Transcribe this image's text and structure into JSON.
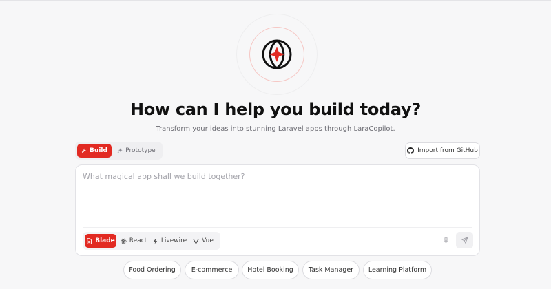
{
  "header": {
    "title": "How can I help you build today?",
    "subtitle": "Transform your ideas into stunning Laravel apps through LaraCopilot."
  },
  "logo": {
    "icon": "globe-sparkle-icon",
    "accent": "#e22a22"
  },
  "mode_switch": {
    "selected": "Build",
    "options": [
      {
        "label": "Build",
        "icon": "wrench-icon"
      },
      {
        "label": "Prototype",
        "icon": "sparkle-icon"
      }
    ]
  },
  "import_button": {
    "label": "Import from GitHub",
    "icon": "github-icon"
  },
  "prompt": {
    "placeholder": "What magical app shall we build together?",
    "value": ""
  },
  "frameworks": {
    "selected": "Blade",
    "options": [
      {
        "label": "Blade",
        "icon": "file-icon"
      },
      {
        "label": "React",
        "icon": "atom-icon"
      },
      {
        "label": "Livewire",
        "icon": "bolt-icon"
      },
      {
        "label": "Vue",
        "icon": "vue-icon"
      }
    ]
  },
  "actions": {
    "mic_icon": "mic-icon",
    "send_icon": "send-icon"
  },
  "suggestions": [
    "Food Ordering",
    "E-commerce",
    "Hotel Booking",
    "Task Manager",
    "Learning Platform"
  ],
  "colors": {
    "accent": "#e22a22",
    "background": "#f7f7f8"
  }
}
